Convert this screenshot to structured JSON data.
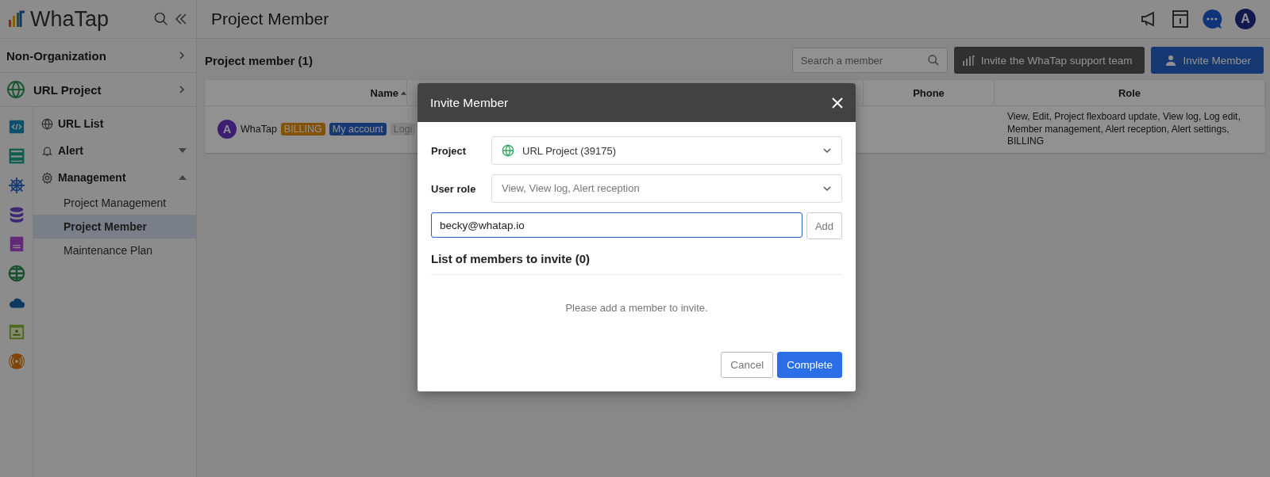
{
  "app": {
    "logo": "WhaTap",
    "avatar": "A"
  },
  "page_title": "Project Member",
  "sidebar": {
    "organization": "Non-Organization",
    "project": "URL Project",
    "menu": [
      {
        "label": "URL List"
      },
      {
        "label": "Alert",
        "expanded": false
      },
      {
        "label": "Management",
        "expanded": true,
        "children": [
          {
            "label": "Project Management",
            "selected": false
          },
          {
            "label": "Project Member",
            "selected": true
          },
          {
            "label": "Maintenance Plan",
            "selected": false
          }
        ]
      }
    ]
  },
  "toolbar": {
    "heading": "Project member (1)",
    "search": {
      "placeholder": "Search a member"
    },
    "support_button": "Invite the WhaTap support team",
    "invite_button": "Invite Member"
  },
  "table": {
    "columns": [
      {
        "label": "Name",
        "sorted": true
      },
      {
        "label": "Phone"
      },
      {
        "label": "Role"
      }
    ],
    "rows": [
      {
        "avatar": "A",
        "name": "WhaTap",
        "tags": [
          {
            "label": "BILLING",
            "kind": "billing"
          },
          {
            "label": "My account",
            "kind": "account"
          },
          {
            "label": "Logi",
            "kind": "status"
          }
        ],
        "role": "View, Edit, Project flexboard update, View log, Log edit, Member management, Alert reception, Alert settings, BILLING"
      }
    ]
  },
  "dialog": {
    "title": "Invite Member",
    "fields": [
      {
        "label": "Project",
        "value": "URL Project (39175)",
        "kind": "project"
      },
      {
        "label": "User role",
        "value": "View, View log, Alert reception",
        "kind": "role"
      }
    ],
    "email": {
      "value": "becky@whatap.io"
    },
    "add_button": "Add",
    "list_heading": "List of members to invite (0)",
    "empty_message": "Please add a member to invite.",
    "buttons": [
      {
        "label": "Cancel",
        "kind": "secondary"
      },
      {
        "label": "Complete",
        "kind": "primary"
      }
    ]
  }
}
